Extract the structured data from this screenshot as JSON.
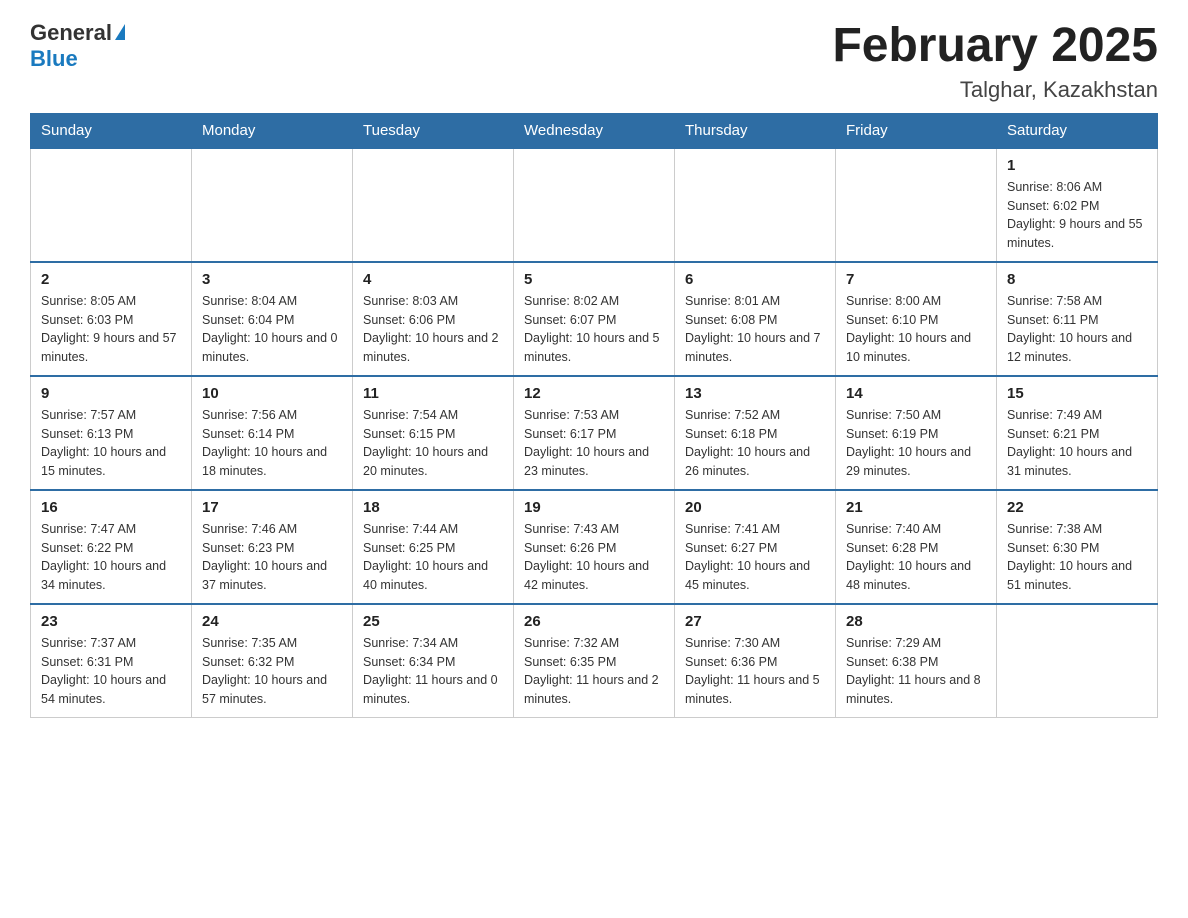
{
  "header": {
    "logo_general": "General",
    "logo_blue": "Blue",
    "month_title": "February 2025",
    "location": "Talghar, Kazakhstan"
  },
  "days_of_week": [
    "Sunday",
    "Monday",
    "Tuesday",
    "Wednesday",
    "Thursday",
    "Friday",
    "Saturday"
  ],
  "weeks": [
    {
      "days": [
        {
          "number": "",
          "info": ""
        },
        {
          "number": "",
          "info": ""
        },
        {
          "number": "",
          "info": ""
        },
        {
          "number": "",
          "info": ""
        },
        {
          "number": "",
          "info": ""
        },
        {
          "number": "",
          "info": ""
        },
        {
          "number": "1",
          "info": "Sunrise: 8:06 AM\nSunset: 6:02 PM\nDaylight: 9 hours and 55 minutes."
        }
      ]
    },
    {
      "days": [
        {
          "number": "2",
          "info": "Sunrise: 8:05 AM\nSunset: 6:03 PM\nDaylight: 9 hours and 57 minutes."
        },
        {
          "number": "3",
          "info": "Sunrise: 8:04 AM\nSunset: 6:04 PM\nDaylight: 10 hours and 0 minutes."
        },
        {
          "number": "4",
          "info": "Sunrise: 8:03 AM\nSunset: 6:06 PM\nDaylight: 10 hours and 2 minutes."
        },
        {
          "number": "5",
          "info": "Sunrise: 8:02 AM\nSunset: 6:07 PM\nDaylight: 10 hours and 5 minutes."
        },
        {
          "number": "6",
          "info": "Sunrise: 8:01 AM\nSunset: 6:08 PM\nDaylight: 10 hours and 7 minutes."
        },
        {
          "number": "7",
          "info": "Sunrise: 8:00 AM\nSunset: 6:10 PM\nDaylight: 10 hours and 10 minutes."
        },
        {
          "number": "8",
          "info": "Sunrise: 7:58 AM\nSunset: 6:11 PM\nDaylight: 10 hours and 12 minutes."
        }
      ]
    },
    {
      "days": [
        {
          "number": "9",
          "info": "Sunrise: 7:57 AM\nSunset: 6:13 PM\nDaylight: 10 hours and 15 minutes."
        },
        {
          "number": "10",
          "info": "Sunrise: 7:56 AM\nSunset: 6:14 PM\nDaylight: 10 hours and 18 minutes."
        },
        {
          "number": "11",
          "info": "Sunrise: 7:54 AM\nSunset: 6:15 PM\nDaylight: 10 hours and 20 minutes."
        },
        {
          "number": "12",
          "info": "Sunrise: 7:53 AM\nSunset: 6:17 PM\nDaylight: 10 hours and 23 minutes."
        },
        {
          "number": "13",
          "info": "Sunrise: 7:52 AM\nSunset: 6:18 PM\nDaylight: 10 hours and 26 minutes."
        },
        {
          "number": "14",
          "info": "Sunrise: 7:50 AM\nSunset: 6:19 PM\nDaylight: 10 hours and 29 minutes."
        },
        {
          "number": "15",
          "info": "Sunrise: 7:49 AM\nSunset: 6:21 PM\nDaylight: 10 hours and 31 minutes."
        }
      ]
    },
    {
      "days": [
        {
          "number": "16",
          "info": "Sunrise: 7:47 AM\nSunset: 6:22 PM\nDaylight: 10 hours and 34 minutes."
        },
        {
          "number": "17",
          "info": "Sunrise: 7:46 AM\nSunset: 6:23 PM\nDaylight: 10 hours and 37 minutes."
        },
        {
          "number": "18",
          "info": "Sunrise: 7:44 AM\nSunset: 6:25 PM\nDaylight: 10 hours and 40 minutes."
        },
        {
          "number": "19",
          "info": "Sunrise: 7:43 AM\nSunset: 6:26 PM\nDaylight: 10 hours and 42 minutes."
        },
        {
          "number": "20",
          "info": "Sunrise: 7:41 AM\nSunset: 6:27 PM\nDaylight: 10 hours and 45 minutes."
        },
        {
          "number": "21",
          "info": "Sunrise: 7:40 AM\nSunset: 6:28 PM\nDaylight: 10 hours and 48 minutes."
        },
        {
          "number": "22",
          "info": "Sunrise: 7:38 AM\nSunset: 6:30 PM\nDaylight: 10 hours and 51 minutes."
        }
      ]
    },
    {
      "days": [
        {
          "number": "23",
          "info": "Sunrise: 7:37 AM\nSunset: 6:31 PM\nDaylight: 10 hours and 54 minutes."
        },
        {
          "number": "24",
          "info": "Sunrise: 7:35 AM\nSunset: 6:32 PM\nDaylight: 10 hours and 57 minutes."
        },
        {
          "number": "25",
          "info": "Sunrise: 7:34 AM\nSunset: 6:34 PM\nDaylight: 11 hours and 0 minutes."
        },
        {
          "number": "26",
          "info": "Sunrise: 7:32 AM\nSunset: 6:35 PM\nDaylight: 11 hours and 2 minutes."
        },
        {
          "number": "27",
          "info": "Sunrise: 7:30 AM\nSunset: 6:36 PM\nDaylight: 11 hours and 5 minutes."
        },
        {
          "number": "28",
          "info": "Sunrise: 7:29 AM\nSunset: 6:38 PM\nDaylight: 11 hours and 8 minutes."
        },
        {
          "number": "",
          "info": ""
        }
      ]
    }
  ]
}
